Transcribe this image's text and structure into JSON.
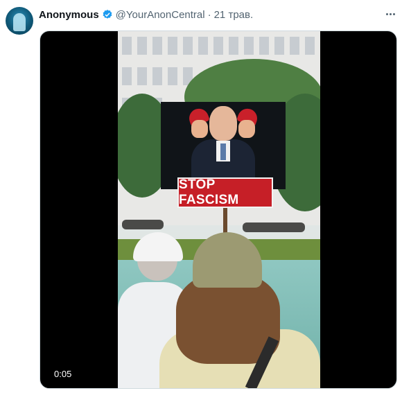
{
  "author": {
    "name": "Anonymous",
    "handle": "@YourAnonCentral",
    "separator": "·",
    "date": "21 трав.",
    "verified_icon": "verified-badge-icon",
    "brand_color": "#1d9bf0"
  },
  "media": {
    "sign_text": "STOP FASCISM",
    "duration": "0:05"
  }
}
